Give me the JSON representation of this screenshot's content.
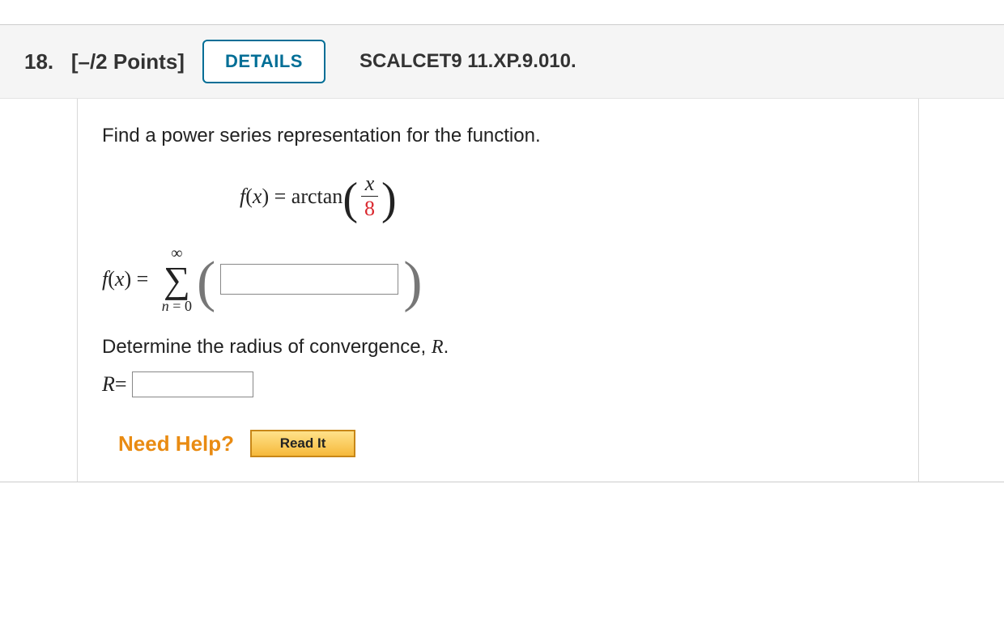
{
  "header": {
    "number": "18.",
    "points": "[–/2 Points]",
    "details_label": "DETAILS",
    "reference": "SCALCET9 11.XP.9.010."
  },
  "question": {
    "prompt": "Find a power series representation for the function.",
    "equation_given": {
      "lhs_f": "f",
      "lhs_arg": "x",
      "rhs_fn": "arctan",
      "frac_num": "x",
      "frac_den": "8"
    },
    "series": {
      "lhs_f": "f",
      "lhs_arg": "x",
      "upper": "∞",
      "sigma": "∑",
      "lower_var": "n",
      "lower_eq": " = 0",
      "term_input_value": ""
    },
    "prompt2": "Determine the radius of convergence, ",
    "prompt2_var": "R",
    "prompt2_end": ".",
    "r_label": "R",
    "r_eq": " = ",
    "r_input_value": ""
  },
  "help": {
    "label": "Need Help?",
    "read_it": "Read It"
  }
}
